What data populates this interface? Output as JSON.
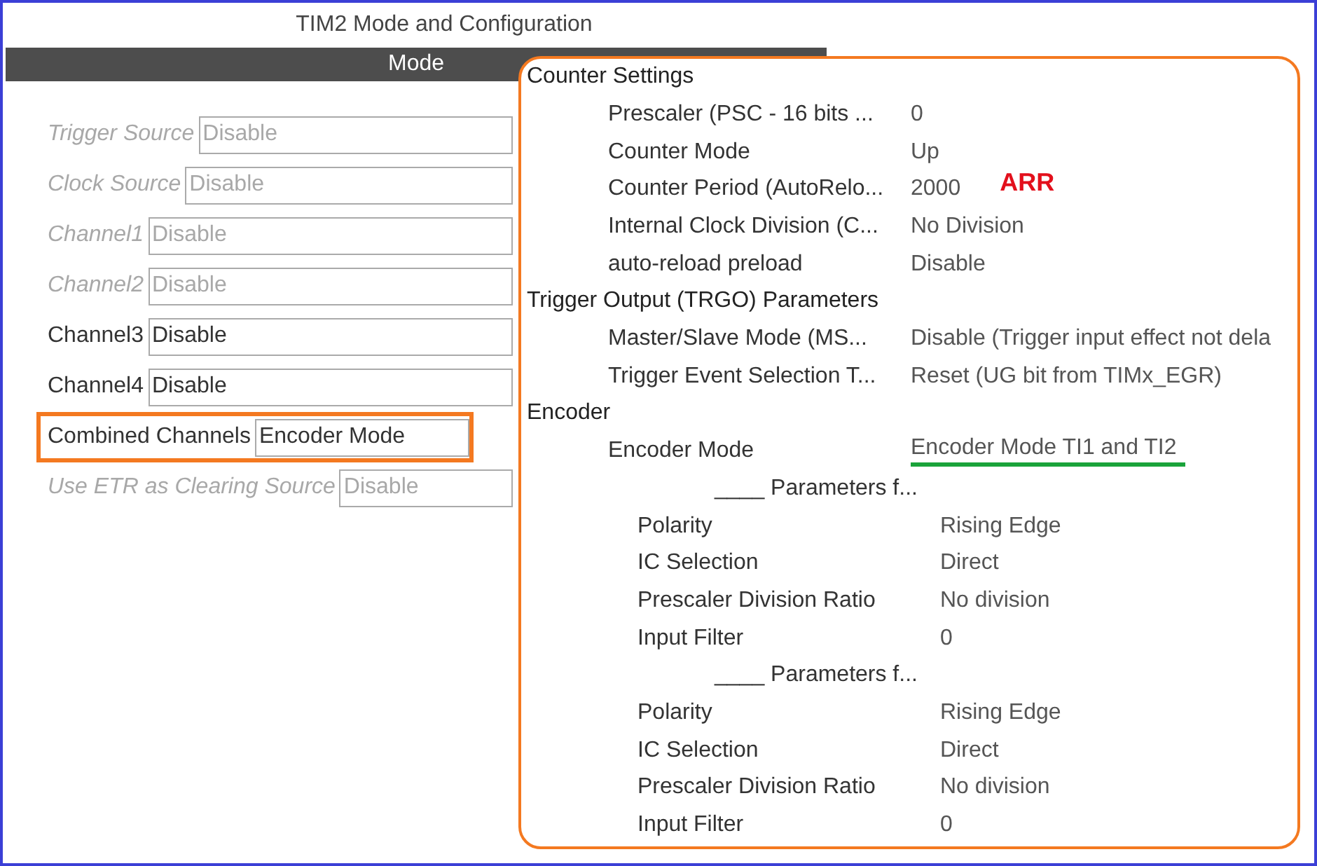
{
  "window": {
    "title": "TIM2 Mode and Configuration"
  },
  "mode_bar": {
    "title": "Mode"
  },
  "mode_rows": [
    {
      "label": "Trigger Source",
      "value": "Disable",
      "disabled": true,
      "highlighted": false
    },
    {
      "label": "Clock Source",
      "value": "Disable",
      "disabled": true,
      "highlighted": false
    },
    {
      "label": "Channel1",
      "value": "Disable",
      "disabled": true,
      "highlighted": false
    },
    {
      "label": "Channel2",
      "value": "Disable",
      "disabled": true,
      "highlighted": false
    },
    {
      "label": "Channel3",
      "value": "Disable",
      "disabled": false,
      "highlighted": false
    },
    {
      "label": "Channel4",
      "value": "Disable",
      "disabled": false,
      "highlighted": false
    },
    {
      "label": "Combined Channels",
      "value": "Encoder Mode",
      "disabled": false,
      "highlighted": true
    },
    {
      "label": "Use ETR as Clearing Source",
      "value": "Disable",
      "disabled": true,
      "highlighted": false
    }
  ],
  "parameter_sections": [
    {
      "title": "Counter Settings",
      "params": [
        {
          "label": "Prescaler (PSC - 16 bits ...",
          "value": "0"
        },
        {
          "label": "Counter Mode",
          "value": "Up"
        },
        {
          "label": "Counter Period (AutoRelo...",
          "value": "2000",
          "annotation": "ARR"
        },
        {
          "label": "Internal Clock Division (C...",
          "value": "No Division"
        },
        {
          "label": "auto-reload preload",
          "value": "Disable"
        }
      ]
    },
    {
      "title": "Trigger Output (TRGO) Parameters",
      "params": [
        {
          "label": "Master/Slave Mode (MS...",
          "value": "Disable (Trigger input effect not dela"
        },
        {
          "label": "Trigger Event Selection T...",
          "value": "Reset (UG bit from TIMx_EGR)"
        }
      ]
    },
    {
      "title": "Encoder",
      "params": [
        {
          "label": "Encoder Mode",
          "value": "Encoder Mode TI1 and TI2",
          "underlined": true
        }
      ],
      "groups": [
        {
          "title": "____ Parameters f...",
          "params": [
            {
              "label": "Polarity",
              "value": "Rising Edge"
            },
            {
              "label": "IC Selection",
              "value": "Direct"
            },
            {
              "label": "Prescaler Division Ratio",
              "value": "No division"
            },
            {
              "label": "Input Filter",
              "value": "0"
            }
          ]
        },
        {
          "title": "____ Parameters f...",
          "params": [
            {
              "label": "Polarity",
              "value": "Rising Edge"
            },
            {
              "label": "IC Selection",
              "value": "Direct"
            },
            {
              "label": "Prescaler Division Ratio",
              "value": "No division"
            },
            {
              "label": "Input Filter",
              "value": "0"
            }
          ]
        }
      ]
    }
  ]
}
